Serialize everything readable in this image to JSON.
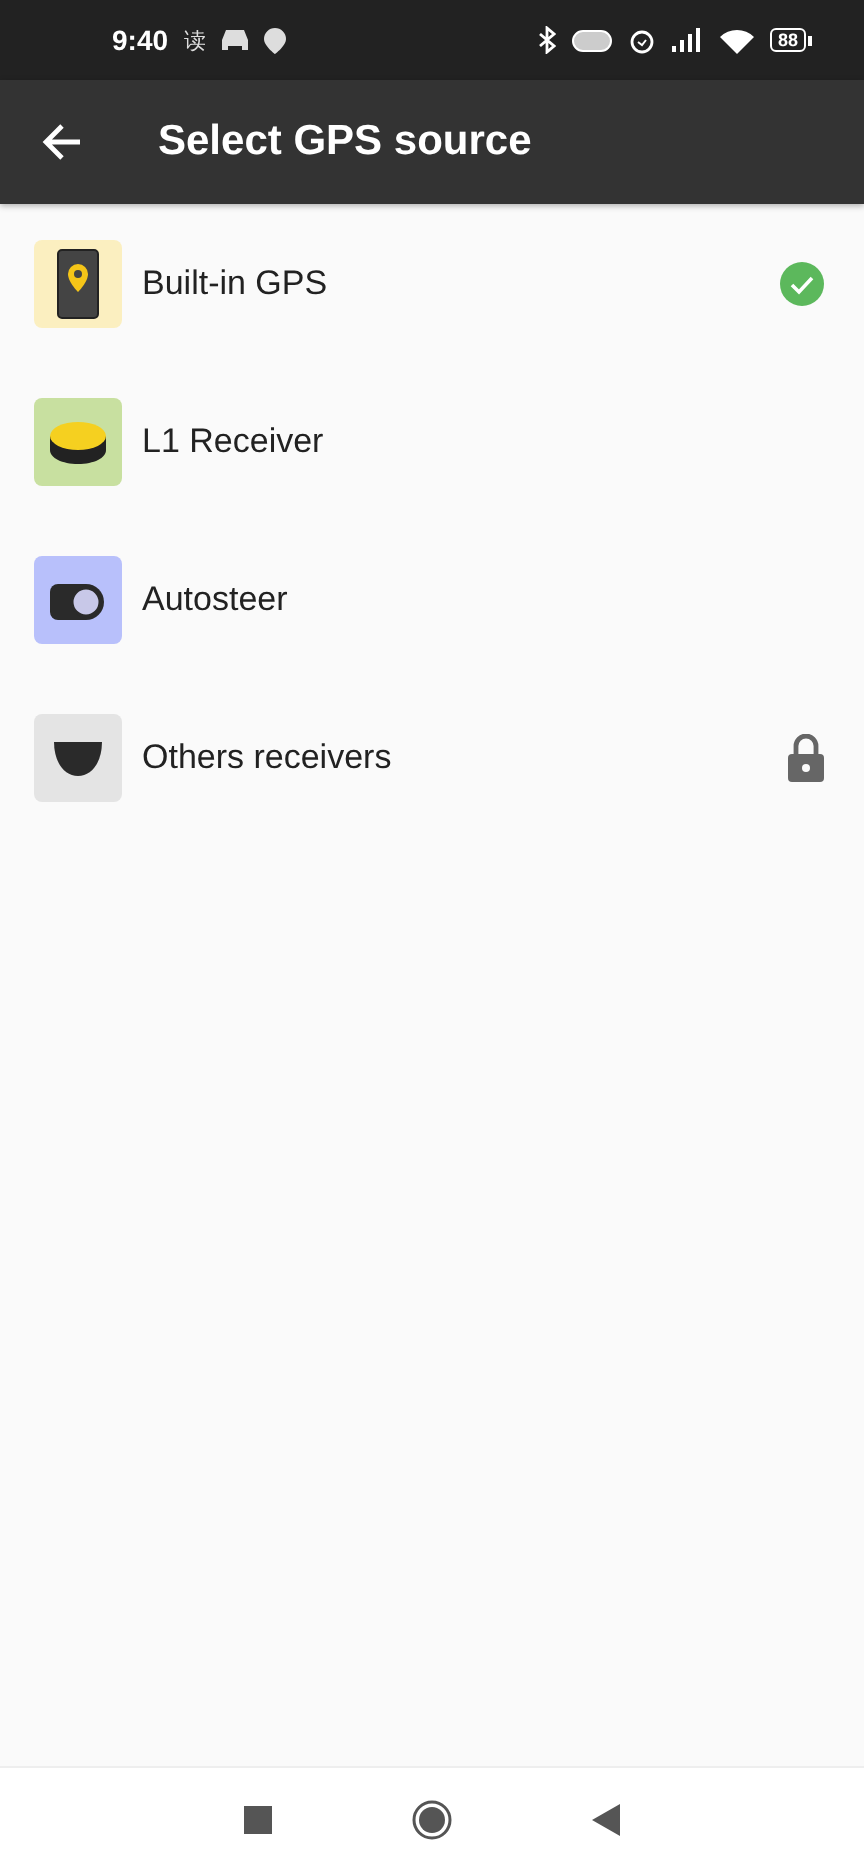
{
  "status_bar": {
    "time": "9:40",
    "notification_text": "读",
    "battery": "88"
  },
  "app_bar": {
    "title": "Select GPS source"
  },
  "sources": [
    {
      "label": "Built-in GPS",
      "kind": "phone",
      "color": "#fbefc0",
      "selected": true,
      "locked": false
    },
    {
      "label": "L1 Receiver",
      "kind": "receiver",
      "color": "#c8e0a0",
      "selected": false,
      "locked": false
    },
    {
      "label": "Autosteer",
      "kind": "autosteer",
      "color": "#b8c0fb",
      "selected": false,
      "locked": false
    },
    {
      "label": "Others receivers",
      "kind": "generic",
      "color": "#e4e4e4",
      "selected": false,
      "locked": true
    }
  ]
}
